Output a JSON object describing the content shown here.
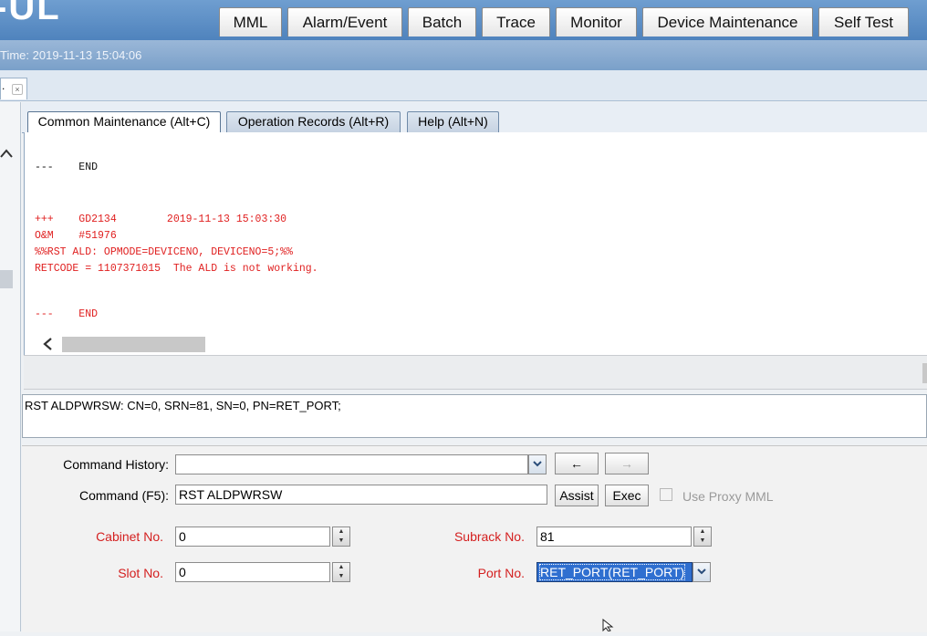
{
  "header": {
    "brand": "-UL",
    "nav": [
      "MML",
      "Alarm/Event",
      "Batch",
      "Trace",
      "Monitor",
      "Device Maintenance",
      "Self Test"
    ],
    "time_text": "Time: 2019-11-13 15:04:06"
  },
  "doc_tab": {
    "label": ".",
    "close": "×"
  },
  "subtabs": [
    "Common Maintenance (Alt+C)",
    "Operation Records (Alt+R)",
    "Help (Alt+N)"
  ],
  "output": {
    "line1": "---    END",
    "line2": "+++    GD2134        2019-11-13 15:03:30",
    "line3": "O&M    #51976",
    "line4": "%%RST ALD: OPMODE=DEVICENO, DEVICENO=5;%%",
    "line5": "RETCODE = 1107371015  The ALD is not working.",
    "line6": "---    END"
  },
  "command_text": "RST ALDPWRSW: CN=0, SRN=81, SN=0, PN=RET_PORT;",
  "form": {
    "history_label": "Command History:",
    "history_value": "",
    "back_arrow": "←",
    "fwd_arrow": "→",
    "command_label": "Command (F5):",
    "command_value": "RST ALDPWRSW",
    "assist_label": "Assist",
    "exec_label": "Exec",
    "proxy_label": "Use Proxy MML",
    "cabinet_label": "Cabinet No.",
    "cabinet_value": "0",
    "subrack_label": "Subrack No.",
    "subrack_value": "81",
    "slot_label": "Slot No.",
    "slot_value": "0",
    "port_label": "Port No.",
    "port_value": "RET_PORT(RET_PORT)"
  },
  "colors": {
    "header_blue": "#4f83bd",
    "required_red": "#d42020",
    "selection_blue": "#2f6fd0"
  }
}
